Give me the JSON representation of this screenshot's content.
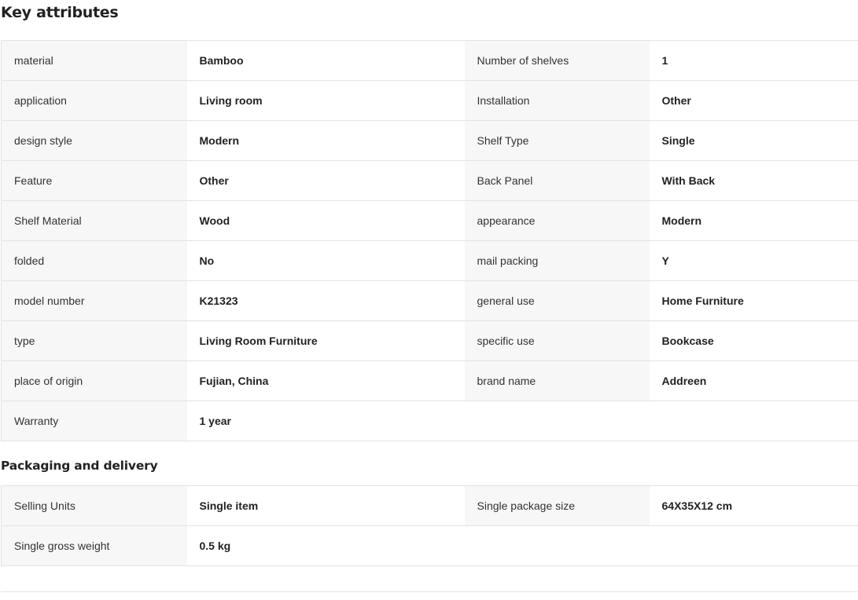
{
  "key_attributes": {
    "title": "Key attributes",
    "rows": [
      {
        "label1": "material",
        "value1": "Bamboo",
        "label2": "Number of shelves",
        "value2": "1"
      },
      {
        "label1": "application",
        "value1": "Living room",
        "label2": "Installation",
        "value2": "Other"
      },
      {
        "label1": "design style",
        "value1": "Modern",
        "label2": "Shelf Type",
        "value2": "Single"
      },
      {
        "label1": "Feature",
        "value1": "Other",
        "label2": "Back Panel",
        "value2": "With Back"
      },
      {
        "label1": "Shelf Material",
        "value1": "Wood",
        "label2": "appearance",
        "value2": "Modern"
      },
      {
        "label1": "folded",
        "value1": "No",
        "label2": "mail packing",
        "value2": "Y"
      },
      {
        "label1": "model number",
        "value1": "K21323",
        "label2": "general use",
        "value2": "Home Furniture"
      },
      {
        "label1": "type",
        "value1": "Living Room Furniture",
        "label2": "specific use",
        "value2": "Bookcase"
      },
      {
        "label1": "place of origin",
        "value1": "Fujian, China",
        "label2": "brand name",
        "value2": "Addreen"
      },
      {
        "label1": "Warranty",
        "value1": "1 year"
      }
    ]
  },
  "packaging": {
    "title": "Packaging and delivery",
    "rows": [
      {
        "label1": "Selling Units",
        "value1": "Single item",
        "label2": "Single package size",
        "value2": "64X35X12 cm"
      },
      {
        "label1": "Single gross weight",
        "value1": "0.5 kg"
      }
    ]
  }
}
